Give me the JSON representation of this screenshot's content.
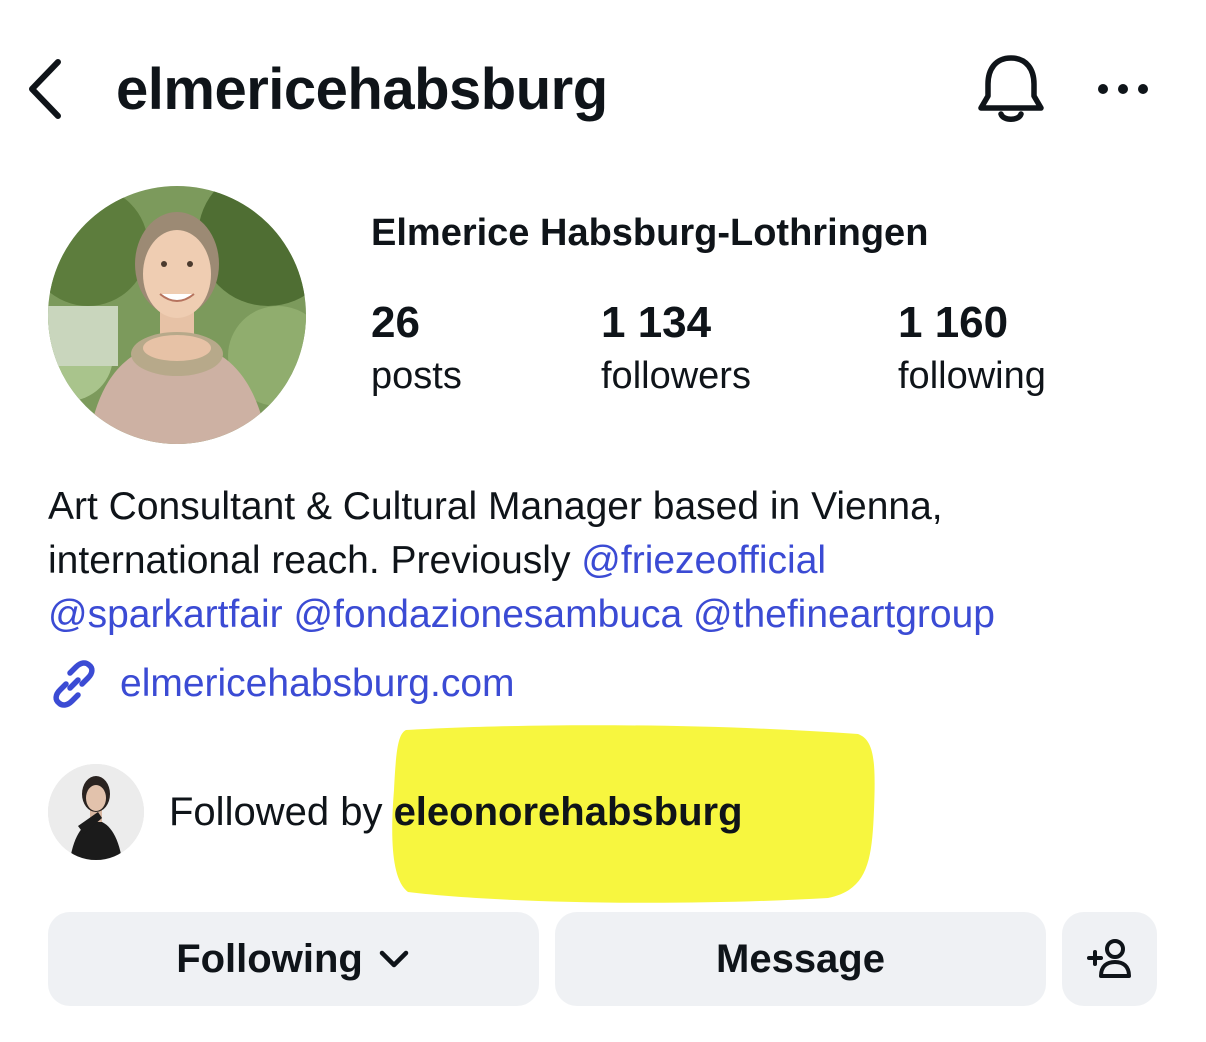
{
  "header": {
    "username": "elmericehabsburg",
    "icons": [
      "back-chevron-icon",
      "bell-icon",
      "more-icon"
    ]
  },
  "profile": {
    "full_name": "Elmerice Habsburg-Lothringen",
    "stats": {
      "posts": {
        "value": "26",
        "label": "posts"
      },
      "followers": {
        "value": "1 134",
        "label": "followers"
      },
      "following": {
        "value": "1 160",
        "label": "following"
      }
    },
    "bio": {
      "line1": "Art Consultant & Cultural Manager based in Vienna,",
      "line2_text": "international reach. Previously ",
      "mentions": [
        "@friezeofficial",
        "@sparkartfair",
        "@fondazionesambuca",
        "@thefineartgroup"
      ]
    },
    "website": "elmericehabsburg.com"
  },
  "followed_by": {
    "prefix": "Followed by ",
    "user": "eleonorehabsburg",
    "highlight_color": "#f7f535"
  },
  "buttons": {
    "following": "Following",
    "message": "Message",
    "add_user_icon": "add-person-icon"
  },
  "colors": {
    "link": "#3b4bd4",
    "button_bg": "#eff1f4",
    "text": "#0f1419"
  }
}
